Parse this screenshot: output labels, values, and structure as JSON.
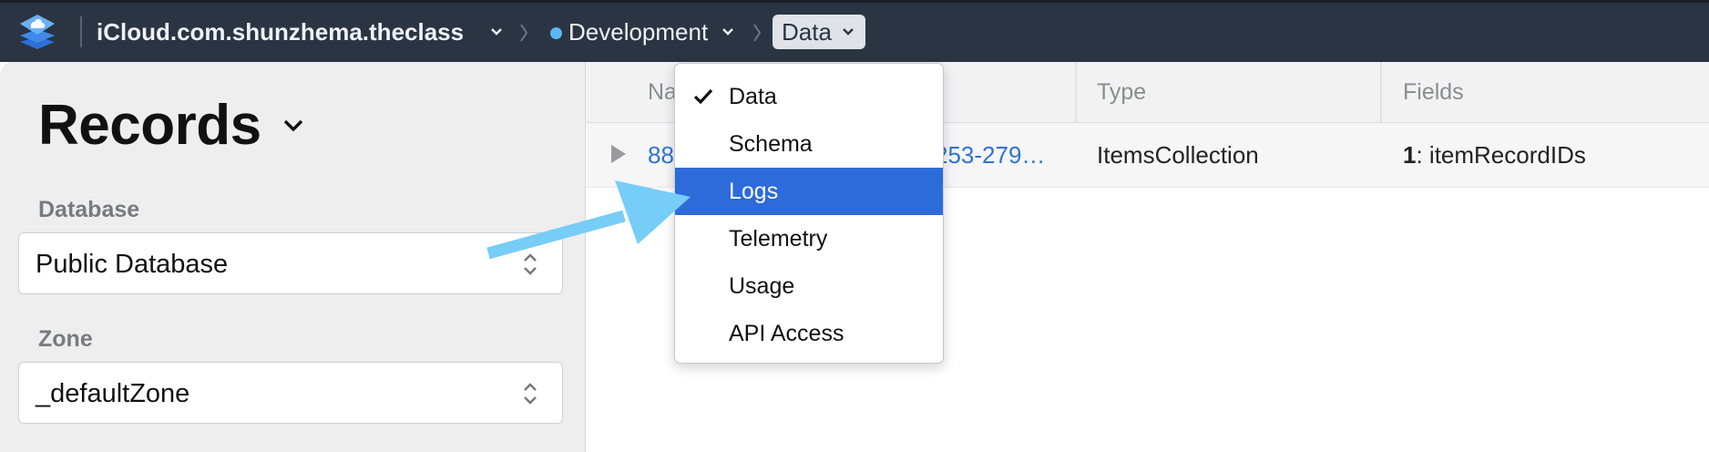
{
  "header": {
    "container": "iCloud.com.shunzhema.theclass",
    "environment": "Development",
    "section": "Data"
  },
  "sidebar": {
    "title": "Records",
    "database_label": "Database",
    "database_value": "Public Database",
    "zone_label": "Zone",
    "zone_value": "_defaultZone"
  },
  "table": {
    "columns": [
      "Na",
      "Type",
      "Fields"
    ],
    "rows": [
      {
        "name_start": "88",
        "name_end": "253-279…",
        "type": "ItemsCollection",
        "fields_count": "1",
        "fields_suffix": ": itemRecordIDs"
      }
    ]
  },
  "menu": {
    "items": [
      {
        "label": "Data",
        "checked": true
      },
      {
        "label": "Schema"
      },
      {
        "label": "Logs",
        "highlighted": true
      },
      {
        "label": "Telemetry"
      },
      {
        "label": "Usage"
      },
      {
        "label": "API Access"
      }
    ]
  },
  "colors": {
    "topbar": "#2b3442",
    "menu_highlight": "#2d6bdb",
    "link": "#2f72d6",
    "annotation_arrow": "#76cdf7"
  },
  "icons": [
    "cloudkit-layers-icon",
    "chevron-down-icon",
    "chevron-right-icon",
    "updown-chevron-icon",
    "checkmark-icon",
    "disclosure-triangle-icon"
  ]
}
